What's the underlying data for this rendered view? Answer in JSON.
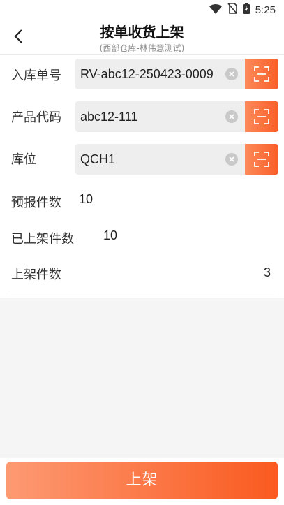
{
  "status_bar": {
    "time": "5:25",
    "icons": [
      "wifi-icon",
      "no-sim-icon",
      "battery-charging-icon"
    ]
  },
  "header": {
    "title": "按单收货上架",
    "subtitle": "(西部仓库-林伟意测试)",
    "back_icon": "back-arrow-icon"
  },
  "form": {
    "inbound_no": {
      "label": "入库单号",
      "value": "RV-abc12-250423-0009"
    },
    "product_code": {
      "label": "产品代码",
      "value": "abc12-111"
    },
    "location": {
      "label": "库位",
      "value": "QCH1"
    },
    "forecast_qty": {
      "label": "预报件数",
      "value": "10"
    },
    "shelved_qty": {
      "label": "已上架件数",
      "value": "10"
    },
    "shelve_qty": {
      "label": "上架件数",
      "value": "3"
    }
  },
  "footer": {
    "submit_label": "上架"
  },
  "colors": {
    "accent_start": "#fd9a73",
    "accent_end": "#fa5a1f"
  }
}
